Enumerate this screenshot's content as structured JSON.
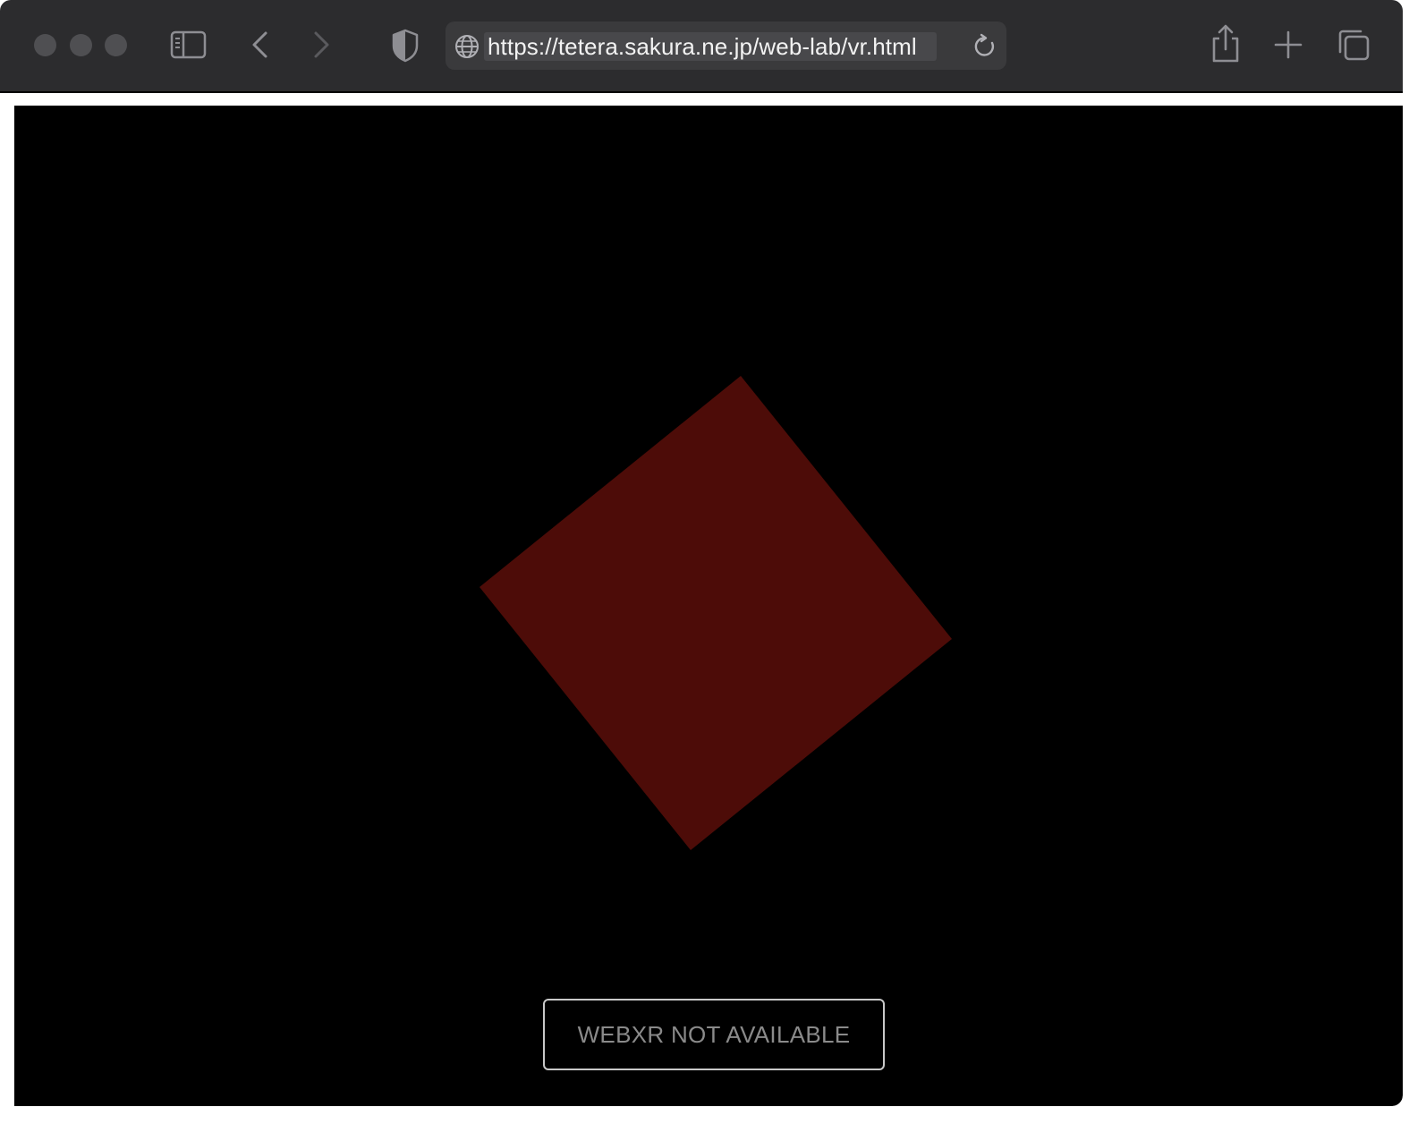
{
  "browser": {
    "url": "https://tetera.sakura.ne.jp/web-lab/vr.html",
    "icons": {
      "close": "window-close-button",
      "minimize": "window-minimize-button",
      "zoom": "window-zoom-button",
      "sidebar": "sidebar-icon",
      "back": "chevron-left-icon",
      "forward": "chevron-right-icon",
      "privacy": "shield-icon",
      "site": "globe-icon",
      "reload": "reload-icon",
      "share": "share-icon",
      "new_tab": "plus-icon",
      "tabs": "tab-overview-icon"
    }
  },
  "page": {
    "background_color": "#000000",
    "shape_color": "#4d0c08",
    "xr_button_label": "WEBXR NOT AVAILABLE"
  }
}
